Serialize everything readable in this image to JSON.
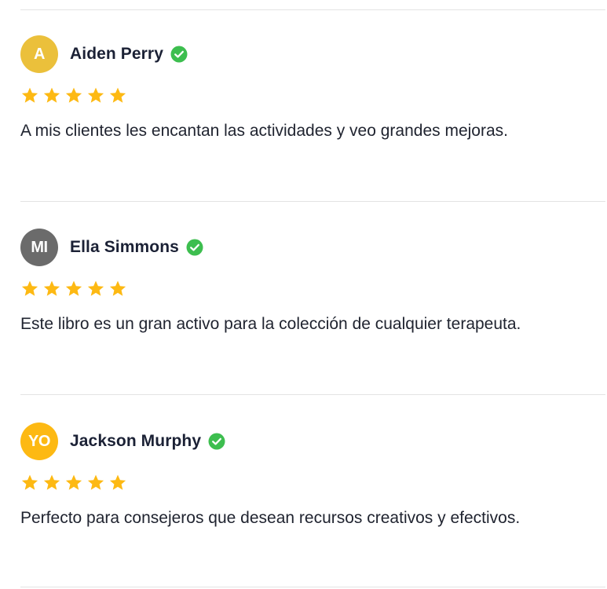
{
  "colors": {
    "star": "#FDB913",
    "verified": "#3DBE4F",
    "divider": "#E3E3E3"
  },
  "reviews": [
    {
      "initials": "A",
      "avatar_color": "#EBC03B",
      "name": "Aiden Perry",
      "verified_icon": "check-circle-icon",
      "rating": 5,
      "text": "A mis clientes les encantan las actividades y veo grandes mejoras."
    },
    {
      "initials": "MI",
      "avatar_color": "#6B6B6B",
      "name": "Ella Simmons",
      "verified_icon": "check-circle-icon",
      "rating": 5,
      "text": "Este libro es un gran activo para la colección de cualquier terapeuta."
    },
    {
      "initials": "YO",
      "avatar_color": "#FDB913",
      "name": "Jackson Murphy",
      "verified_icon": "check-circle-icon",
      "rating": 5,
      "text": "Perfecto para consejeros que desean recursos creativos y efectivos."
    }
  ]
}
